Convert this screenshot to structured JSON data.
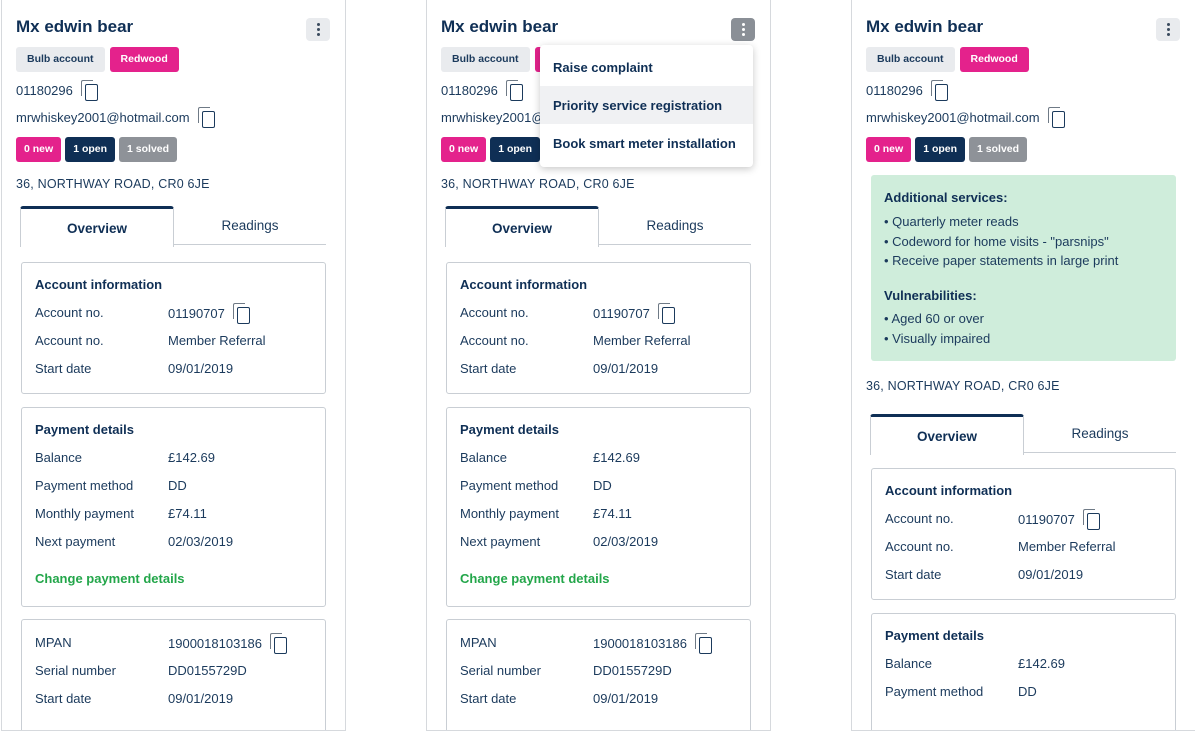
{
  "customer": {
    "name": "Mx edwin bear",
    "badges": [
      "Bulb account",
      "Redwood"
    ],
    "phone": "01180296",
    "email": "mrwhiskey2001@hotmail.com",
    "tickets": {
      "new": "0 new",
      "open": "1 open",
      "solved": "1 solved"
    },
    "address": "36, NORTHWAY ROAD, CR0 6JE"
  },
  "tabs": {
    "overview": "Overview",
    "readings": "Readings"
  },
  "account_info": {
    "title": "Account information",
    "rows": [
      {
        "label": "Account no.",
        "value": "01190707"
      },
      {
        "label": "Account no.",
        "value": "Member Referral"
      },
      {
        "label": "Start date",
        "value": "09/01/2019"
      }
    ]
  },
  "payment": {
    "title": "Payment details",
    "rows": [
      {
        "label": "Balance",
        "value": "£142.69"
      },
      {
        "label": "Payment method",
        "value": "DD"
      },
      {
        "label": "Monthly payment",
        "value": "£74.11"
      },
      {
        "label": "Next payment",
        "value": "02/03/2019"
      }
    ],
    "link": "Change payment details"
  },
  "meter": {
    "rows": [
      {
        "label": "MPAN",
        "value": "1900018103186"
      },
      {
        "label": "Serial number",
        "value": "DD0155729D"
      },
      {
        "label": "Start date",
        "value": "09/01/2019"
      }
    ]
  },
  "menu": {
    "items": [
      "Raise complaint",
      "Priority service registration",
      "Book smart meter installation"
    ]
  },
  "services": {
    "additional_title": "Additional services:",
    "additional": [
      "• Quarterly meter reads",
      "• Codeword for home visits - \"parsnips\"",
      "• Receive paper statements in large print"
    ],
    "vuln_title": "Vulnerabilities:",
    "vulnerabilities": [
      "• Aged 60 or over",
      "• Visually impaired"
    ]
  },
  "colors": {
    "brand_pink": "#e4228c",
    "navy": "#0f2f55",
    "green_link": "#23a64a",
    "services_bg": "#cfeddb"
  }
}
